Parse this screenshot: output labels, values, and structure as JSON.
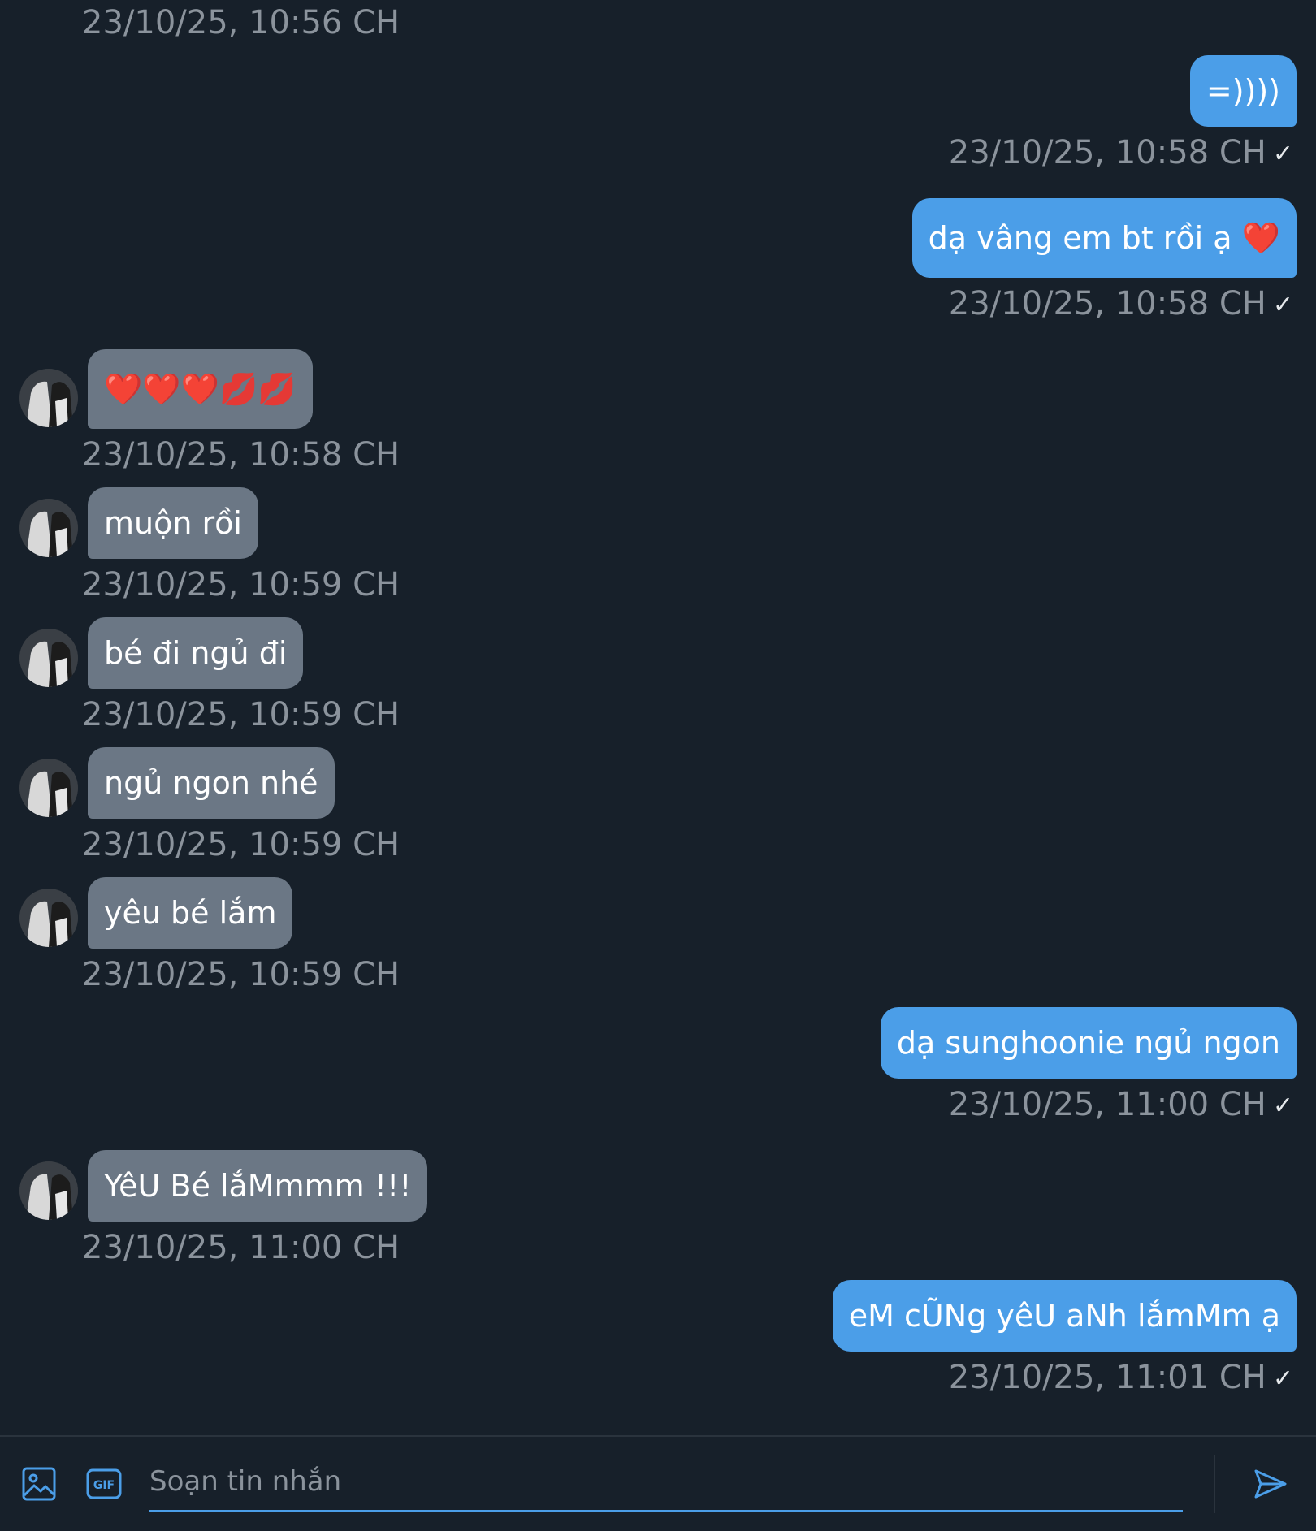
{
  "thread": {
    "messages": [
      {
        "direction": "in",
        "text": "",
        "time": "23/10/25, 10:56 CH"
      },
      {
        "direction": "out",
        "text": "=))))",
        "time": "23/10/25, 10:58 CH",
        "status": "✓"
      },
      {
        "direction": "out",
        "text": "dạ vâng em bt rồi ạ",
        "emoji": "❤️",
        "time": "23/10/25, 10:58 CH",
        "status": "✓"
      },
      {
        "direction": "in",
        "text": "❤️❤️❤️💋💋",
        "time": "23/10/25, 10:58 CH"
      },
      {
        "direction": "in",
        "text": "muộn rồi",
        "time": "23/10/25, 10:59 CH"
      },
      {
        "direction": "in",
        "text": "bé đi ngủ đi",
        "time": "23/10/25, 10:59 CH"
      },
      {
        "direction": "in",
        "text": "ngủ ngon nhé",
        "time": "23/10/25, 10:59 CH"
      },
      {
        "direction": "in",
        "text": "yêu bé lắm",
        "time": "23/10/25, 10:59 CH"
      },
      {
        "direction": "out",
        "text": "dạ sunghoonie ngủ ngon",
        "time": "23/10/25, 11:00 CH",
        "status": "✓"
      },
      {
        "direction": "in",
        "text": "YêU Bé lắMmmm !!!",
        "time": "23/10/25, 11:00 CH"
      },
      {
        "direction": "out",
        "text": "eM cŨNg yêU aNh lắmMm ạ",
        "time": "23/10/25, 11:01 CH",
        "status": "✓"
      }
    ]
  },
  "composer": {
    "placeholder": "Soạn tin nhắn",
    "image_icon": "image-icon",
    "gif_icon": "gif-icon",
    "gif_label": "GIF",
    "send_icon": "send-icon"
  },
  "colors": {
    "background": "#17202a",
    "outgoing_bubble": "#4b9ee8",
    "incoming_bubble": "#6b7785",
    "timestamp": "#8b939c",
    "accent": "#4b9ee8"
  }
}
